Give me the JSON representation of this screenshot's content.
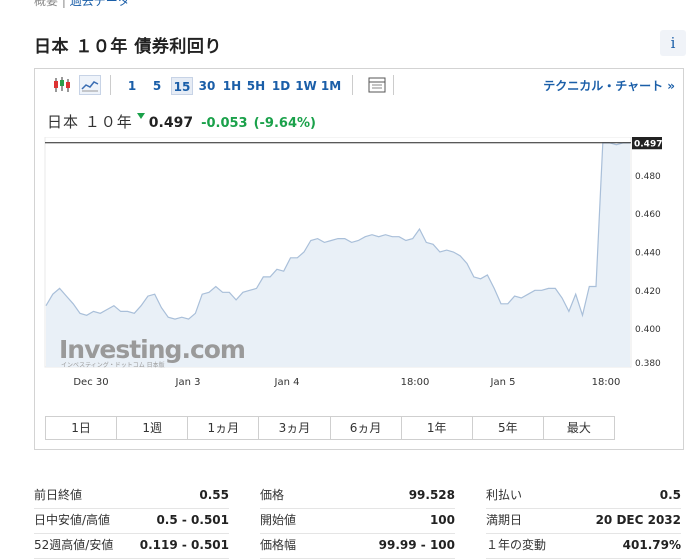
{
  "top_fragment": {
    "part1": "概要",
    "part2": "過去データ"
  },
  "page_title": "日本 １０年 債券利回り",
  "info_label": "i",
  "toolbar": {
    "chart_type_icons": [
      "candlestick-icon",
      "area-chart-icon"
    ],
    "timeframes": [
      "1",
      "5",
      "15",
      "30",
      "1H",
      "5H",
      "1D",
      "1W",
      "1M"
    ],
    "active_timeframe": "15",
    "table_icon": "table-icon",
    "technical_link": "テクニカル・チャート »"
  },
  "quote": {
    "name": "日本 １０年",
    "price": "0.497",
    "change": "-0.053",
    "change_pct": "(-9.64%)",
    "direction": "down",
    "change_color": "#1aa14a"
  },
  "chart_data": {
    "type": "area",
    "x_labels": [
      "Dec 30",
      "Jan 3",
      "Jan 4",
      "18:00",
      "Jan 5",
      "18:00"
    ],
    "y_ticks": [
      "0.400",
      "0.420",
      "0.440",
      "0.460",
      "0.480"
    ],
    "y_bottom_label": "0.380",
    "ylim": [
      0.38,
      0.5
    ],
    "current_value_label": "0.497",
    "current_value": 0.497,
    "watermark": "Investing.com",
    "watermark_sub": "インベスティング・ドットコム 日本版",
    "line_color": "#a9bfd9",
    "fill_color": "#e9f0f7",
    "values": [
      0.412,
      0.418,
      0.421,
      0.417,
      0.413,
      0.408,
      0.407,
      0.409,
      0.408,
      0.41,
      0.412,
      0.409,
      0.409,
      0.408,
      0.412,
      0.417,
      0.418,
      0.411,
      0.406,
      0.405,
      0.406,
      0.405,
      0.408,
      0.418,
      0.419,
      0.422,
      0.419,
      0.419,
      0.415,
      0.419,
      0.42,
      0.421,
      0.427,
      0.427,
      0.431,
      0.43,
      0.437,
      0.437,
      0.44,
      0.446,
      0.447,
      0.445,
      0.446,
      0.447,
      0.447,
      0.445,
      0.446,
      0.448,
      0.449,
      0.448,
      0.449,
      0.448,
      0.448,
      0.446,
      0.447,
      0.452,
      0.445,
      0.444,
      0.44,
      0.441,
      0.44,
      0.438,
      0.434,
      0.427,
      0.426,
      0.428,
      0.421,
      0.413,
      0.413,
      0.417,
      0.416,
      0.418,
      0.42,
      0.42,
      0.421,
      0.421,
      0.416,
      0.409,
      0.418,
      0.407,
      0.422,
      0.422,
      0.497,
      0.497,
      0.496,
      0.497,
      0.497
    ]
  },
  "ranges": [
    "1日",
    "1週",
    "1ヵ月",
    "3ヵ月",
    "6ヵ月",
    "1年",
    "5年",
    "最大"
  ],
  "stats": [
    [
      {
        "label": "前日終値",
        "value": "0.55"
      },
      {
        "label": "日中安値/高値",
        "value": "0.5 - 0.501"
      },
      {
        "label": "52週高値/安値",
        "value": "0.119 - 0.501"
      }
    ],
    [
      {
        "label": "価格",
        "value": "99.528"
      },
      {
        "label": "開始値",
        "value": "100"
      },
      {
        "label": "価格幅",
        "value": "99.99 - 100"
      }
    ],
    [
      {
        "label": "利払い",
        "value": "0.5"
      },
      {
        "label": "満期日",
        "value": "20 DEC 2032"
      },
      {
        "label": "１年の変動",
        "value": "401.79%"
      }
    ]
  ]
}
